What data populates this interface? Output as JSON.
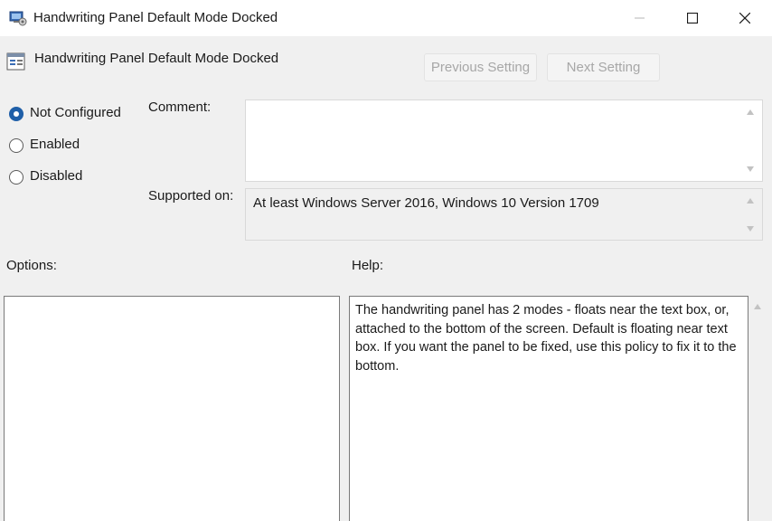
{
  "window": {
    "title": "Handwriting Panel Default Mode Docked",
    "icon": "policy-settings-icon",
    "controls": [
      "minimize-icon",
      "maximize-icon",
      "close-icon"
    ]
  },
  "header": {
    "title": "Handwriting Panel Default Mode Docked",
    "icon": "policy-setting-icon"
  },
  "navigation": {
    "previous_label": "Previous Setting",
    "next_label": "Next Setting"
  },
  "state": {
    "options": [
      {
        "label": "Not Configured",
        "selected": true
      },
      {
        "label": "Enabled",
        "selected": false
      },
      {
        "label": "Disabled",
        "selected": false
      }
    ]
  },
  "comment": {
    "label": "Comment:",
    "value": ""
  },
  "supported": {
    "label": "Supported on:",
    "value": "At least Windows Server 2016, Windows 10 Version 1709"
  },
  "options_panel": {
    "label": "Options:"
  },
  "help_panel": {
    "label": "Help:",
    "text": "The handwriting panel has 2 modes - floats near the text box, or, attached to the bottom of the screen. Default is floating near text box. If you want the panel to be fixed, use this policy to fix it to the bottom."
  },
  "colors": {
    "accent": "#1f5fa8",
    "dialog_background": "#f0f0f0",
    "disabled_text": "#a7a7a7"
  }
}
